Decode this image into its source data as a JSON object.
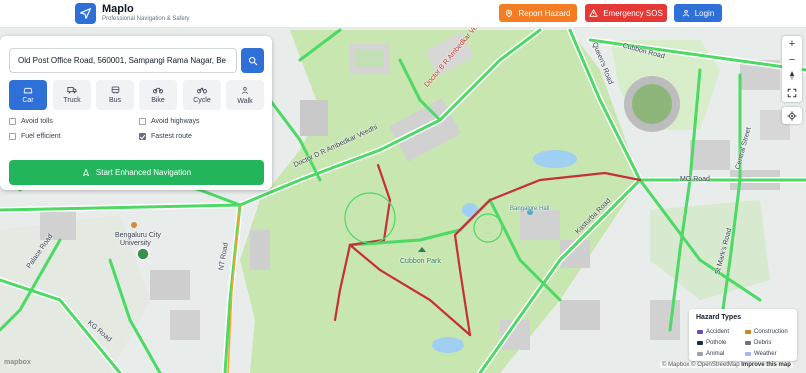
{
  "header": {
    "brand_name": "Maplo",
    "brand_tagline": "Professional Navigation & Safety",
    "report_label": "Report Hazard",
    "sos_label": "Emergency SOS",
    "login_label": "Login",
    "colors": {
      "primary": "#2f6fd8",
      "report": "#f47c23",
      "sos": "#e53935",
      "start": "#23b55c"
    }
  },
  "search": {
    "value": "Old Post Office Road, 560001, Sampangi Rama Nagar, Be",
    "icon": "search-icon"
  },
  "modes": [
    {
      "label": "Car",
      "icon": "car-icon",
      "active": true
    },
    {
      "label": "Truck",
      "icon": "truck-icon",
      "active": false
    },
    {
      "label": "Bus",
      "icon": "bus-icon",
      "active": false
    },
    {
      "label": "Bike",
      "icon": "bike-icon",
      "active": false
    },
    {
      "label": "Cycle",
      "icon": "cycle-icon",
      "active": false
    },
    {
      "label": "Walk",
      "icon": "walk-icon",
      "active": false
    }
  ],
  "options": [
    {
      "label": "Avoid tolls",
      "checked": false
    },
    {
      "label": "Avoid highways",
      "checked": false
    },
    {
      "label": "Fuel efficient",
      "checked": false
    },
    {
      "label": "Fastest route",
      "checked": true
    }
  ],
  "start_label": "Start Enhanced Navigation",
  "map": {
    "labels": {
      "ambedkar1": "Doctor D R Ambedkar Veedhi",
      "ambedkar2": "Doctor B R Ambedkar Veedhi",
      "cubbon_road": "Cubbon Road",
      "queens_road": "Queen's Road",
      "central_street": "Central Street",
      "mg_road": "MG Road",
      "kasturba_road": "Kasturba Road",
      "st_marks_road": "St Mark's Road",
      "palace_road": "Palace Road",
      "nt_road": "NT Road",
      "kg_road": "KG Road",
      "univ1": "Bengaluru City",
      "univ2": "University",
      "cubbon_park": "Cubbon Park",
      "hall": "Bangalore Hall"
    }
  },
  "legend": {
    "title": "Hazard Types",
    "items": [
      {
        "label": "Accident",
        "color": "#6b4fb5"
      },
      {
        "label": "Construction",
        "color": "#c98b1c"
      },
      {
        "label": "Pothole",
        "color": "#1f2937"
      },
      {
        "label": "Debris",
        "color": "#6b7280"
      },
      {
        "label": "Animal",
        "color": "#9ca3af"
      },
      {
        "label": "Weather",
        "color": "#a5b4fc"
      }
    ]
  },
  "attribution": {
    "text": "© Mapbox © OpenStreetMap",
    "improve": "Improve this map",
    "logo": "mapbox"
  },
  "controls": {
    "zoom_in": "+",
    "zoom_out": "−"
  }
}
